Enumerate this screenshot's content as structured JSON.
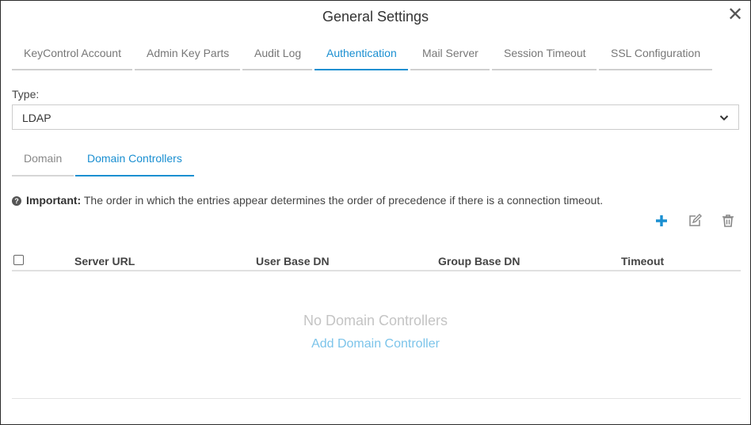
{
  "dialog": {
    "title": "General Settings",
    "close_symbol": "✕"
  },
  "tabs": [
    {
      "label": "KeyControl Account"
    },
    {
      "label": "Admin Key Parts"
    },
    {
      "label": "Audit Log"
    },
    {
      "label": "Authentication"
    },
    {
      "label": "Mail Server"
    },
    {
      "label": "Session Timeout"
    },
    {
      "label": "SSL Configuration"
    }
  ],
  "active_tab": "Authentication",
  "type_field": {
    "label": "Type:",
    "value": "LDAP"
  },
  "subtabs": [
    {
      "label": "Domain"
    },
    {
      "label": "Domain Controllers"
    }
  ],
  "active_subtab": "Domain Controllers",
  "note": {
    "important": "Important:",
    "text": "The order in which the entries appear determines the order of precedence if there is a connection timeout."
  },
  "toolbar": {
    "add_icon": "plus-icon",
    "edit_icon": "edit-icon",
    "delete_icon": "trash-icon"
  },
  "table": {
    "columns": [
      "Server URL",
      "User Base DN",
      "Group Base DN",
      "Timeout"
    ],
    "rows": []
  },
  "empty_state": {
    "title": "No Domain Controllers",
    "link": "Add Domain Controller"
  },
  "colors": {
    "accent": "#1a8fd1",
    "empty_link": "#7cc4ea"
  }
}
